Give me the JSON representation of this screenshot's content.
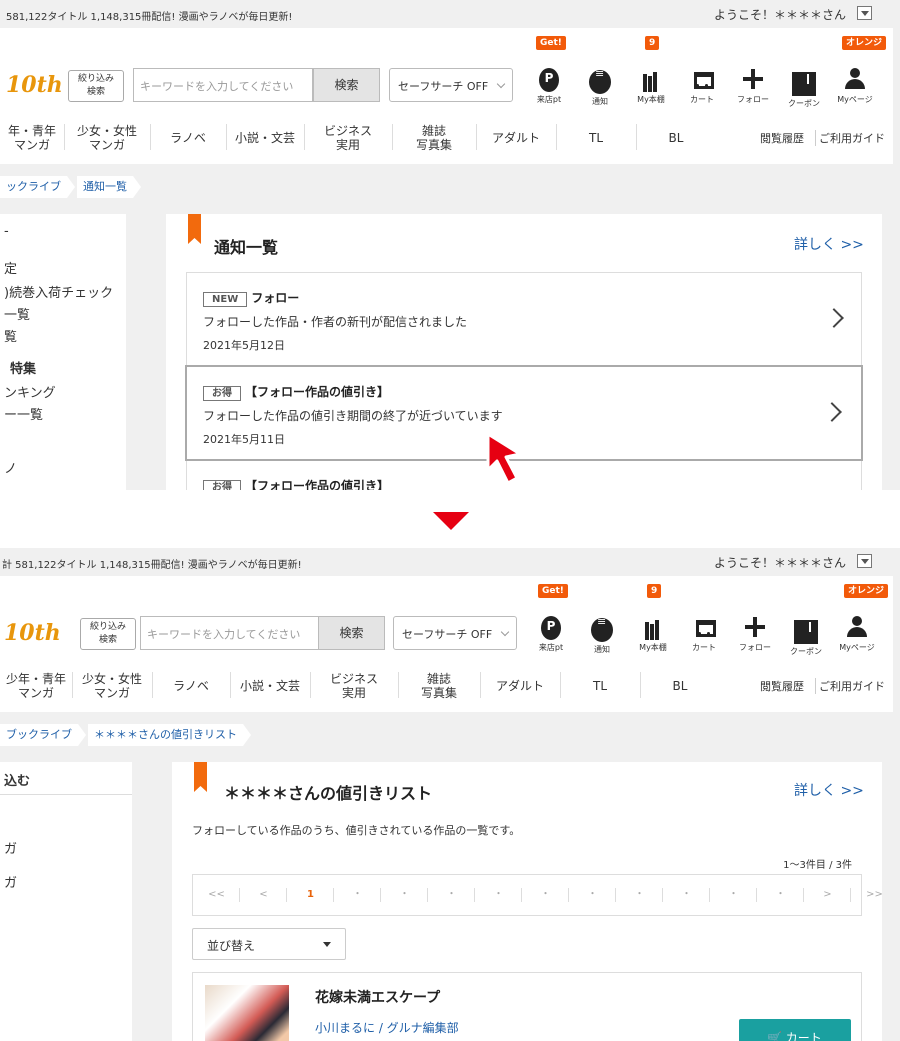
{
  "header": {
    "title_count_1": "581,122タイトル 1,148,315冊配信!  漫画やラノベが毎日更新!",
    "title_count_2": "計 581,122タイトル 1,148,315冊配信!  漫画やラノベが毎日更新!",
    "welcome": "ようこそ！＊＊＊＊さん",
    "logo": "10th",
    "filter_label": "絞り込み\n検索",
    "search_placeholder": "キーワードを入力してください",
    "search_button": "検索",
    "safe_search": "セーフサーチ OFF",
    "icons": [
      {
        "label": "来店pt",
        "badge": "Get!",
        "icon": "point-icon"
      },
      {
        "label": "通知",
        "badge": "",
        "icon": "chat-bubble-icon"
      },
      {
        "label": "My本棚",
        "badge": "9",
        "icon": "bookshelf-icon"
      },
      {
        "label": "カート",
        "badge": "",
        "icon": "cart-icon"
      },
      {
        "label": "フォロー",
        "badge": "",
        "icon": "plus-icon"
      },
      {
        "label": "クーポン",
        "badge": "",
        "icon": "coupon-icon"
      },
      {
        "label": "Myページ",
        "badge": "オレンジ",
        "icon": "user-icon"
      }
    ],
    "nav": [
      "年・青年\nマンガ",
      "少女・女性\nマンガ",
      "ラノベ",
      "小説・文芸",
      "ビジネス\n実用",
      "雑誌\n写真集",
      "アダルト",
      "TL",
      "BL"
    ],
    "nav_2": [
      "少年・青年\nマンガ",
      "少女・女性\nマンガ",
      "ラノベ",
      "小説・文芸",
      "ビジネス\n実用",
      "雑誌\n写真集",
      "アダルト",
      "TL",
      "BL"
    ],
    "history": "閲覧履歴",
    "guide": "ご利用ガイド"
  },
  "shot1": {
    "breadcrumb": [
      "ックライブ",
      "通知一覧"
    ],
    "sidebar": [
      "-",
      "定",
      ")続巻入荷チェック",
      "一覧",
      "覧",
      "特集",
      "ンキング",
      "ー一覧",
      "ノ"
    ],
    "title": "通知一覧",
    "more": "詳しく >>",
    "notifications": [
      {
        "tag": "NEW",
        "title": "フォロー",
        "body": "フォローした作品・作者の新刊が配信されました",
        "date": "2021年5月12日"
      },
      {
        "tag": "お得",
        "title": "【フォロー作品の値引き】",
        "body": "フォローした作品の値引き期間の終了が近づいています",
        "date": "2021年5月11日"
      },
      {
        "tag": "お得",
        "title": "【フォロー作品の値引き】",
        "body": "",
        "date": ""
      }
    ]
  },
  "shot2": {
    "breadcrumb": [
      "ブックライブ",
      "＊＊＊＊さんの値引きリスト"
    ],
    "sidebar": [
      "込む",
      "ガ",
      "ガ"
    ],
    "title": "＊＊＊＊さんの値引きリスト",
    "more": "詳しく >>",
    "description": "フォローしている作品のうち、値引きされている作品の一覧です。",
    "result_count": "1〜3件目 / 3件",
    "pager": [
      "<<",
      "<",
      "1",
      "・",
      "・",
      "・",
      "・",
      "・",
      "・",
      "・",
      "・",
      "・",
      "・",
      ">",
      ">>"
    ],
    "sort_label": "並び替え",
    "book": {
      "title": "花嫁未満エスケープ",
      "author": "小川まるに / グルナ編集部",
      "cart": "カート"
    }
  },
  "colors": {
    "accent": "#f26a0d",
    "link": "#1f5fa8",
    "cart": "#1aa0a0",
    "arrow": "#e60012"
  }
}
